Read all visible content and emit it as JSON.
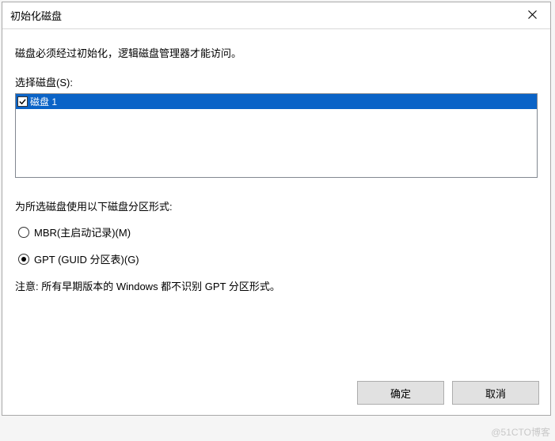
{
  "titlebar": {
    "title": "初始化磁盘"
  },
  "content": {
    "info": "磁盘必须经过初始化，逻辑磁盘管理器才能访问。",
    "select_label": "选择磁盘(S):",
    "disks": [
      {
        "label": "磁盘 1",
        "checked": true
      }
    ],
    "partition_label": "为所选磁盘使用以下磁盘分区形式:",
    "radios": {
      "mbr": {
        "label": "MBR(主启动记录)(M)",
        "checked": false
      },
      "gpt": {
        "label": "GPT (GUID 分区表)(G)",
        "checked": true
      }
    },
    "note": "注意: 所有早期版本的 Windows 都不识别 GPT 分区形式。"
  },
  "buttons": {
    "ok": "确定",
    "cancel": "取消"
  },
  "watermark": "@51CTO博客"
}
